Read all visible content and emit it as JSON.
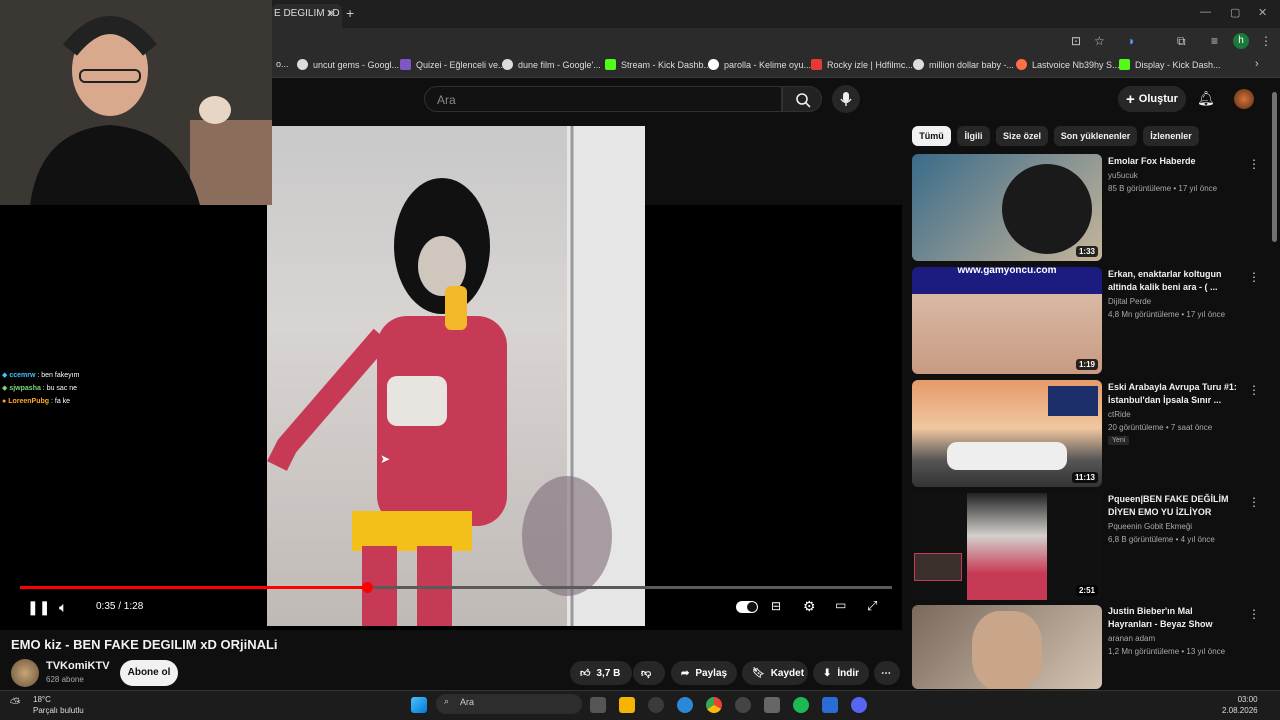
{
  "browser": {
    "active_tab_title": "E DEGILIM xD",
    "bookmarks": [
      {
        "label": "o..."
      },
      {
        "label": "uncut gems - Googl..."
      },
      {
        "label": "Quizei - Eğlenceli ve..."
      },
      {
        "label": "dune film - Google'..."
      },
      {
        "label": "Stream - Kick Dashb..."
      },
      {
        "label": "parolla - Kelime oyu..."
      },
      {
        "label": "Rocky izle | Hdfilmc..."
      },
      {
        "label": "million dollar baby -..."
      },
      {
        "label": "Lastvoice Nb39hy S..."
      },
      {
        "label": "Display - Kick Dash..."
      }
    ],
    "profile_initial": "h"
  },
  "header": {
    "search_placeholder": "Ara",
    "create_label": "Oluştur"
  },
  "chat": [
    {
      "user": "ccemrw",
      "message": "ben fakeyım",
      "color": "#40c4ff"
    },
    {
      "user": "sjwpasha",
      "message": "bu sac ne",
      "color": "#7cd67c"
    },
    {
      "user": "LoreenPubg",
      "message": "fa ke",
      "color": "#ffa726"
    }
  ],
  "player": {
    "time": "0:35 / 1:28",
    "progress": 0.3977
  },
  "video": {
    "title": "EMO kiz - BEN FAKE DEGILIM xD ORjiNALi",
    "channel": "TVKomiKTV",
    "subscribers": "628 abone",
    "subscribe_label": "Abone ol",
    "likes": "3,7 B",
    "share_label": "Paylaş",
    "save_label": "Kaydet",
    "download_label": "İndir"
  },
  "filters": [
    "Tümü",
    "İlgili",
    "Size özel",
    "Son yüklenenler",
    "İzlenenler"
  ],
  "recommendations": [
    {
      "title": "Emolar Fox Haberde",
      "channel": "yu5ucuk",
      "meta": "85 B görüntüleme • 17 yıl önce",
      "duration": "1:33",
      "badge": ""
    },
    {
      "title": "Erkan, enaktarlar koltugun altinda kalik beni ara - ( ...",
      "channel": "Dijital Perde",
      "meta": "4,8 Mn görüntüleme • 17 yıl önce",
      "duration": "1:19",
      "badge": "",
      "thumb_text": "www.gamyoncu.com"
    },
    {
      "title": "Eski Arabayla Avrupa Turu #1: İstanbul'dan İpsala Sınır ...",
      "channel": "ctRide",
      "meta": "20 görüntüleme • 7 saat önce",
      "duration": "11:13",
      "badge": "Yeni"
    },
    {
      "title": "Pqueen|BEN FAKE DEĞİLİM DİYEN EMO YU İZLİYOR",
      "channel": "Pqueenin Gobit Ekmeği",
      "meta": "6,8 B görüntüleme • 4 yıl önce",
      "duration": "2:51",
      "badge": ""
    },
    {
      "title": "Justin Bieber'ın Mal Hayranları - Beyaz Show",
      "channel": "aranan adam",
      "meta": "1,2 Mn görüntüleme • 13 yıl önce",
      "duration": "",
      "badge": ""
    }
  ],
  "taskbar": {
    "weather_temp": "18°C",
    "weather_text": "Parçalı bulutlu",
    "search_placeholder": "Ara",
    "time": "03:00",
    "date": "2.08.2026"
  }
}
